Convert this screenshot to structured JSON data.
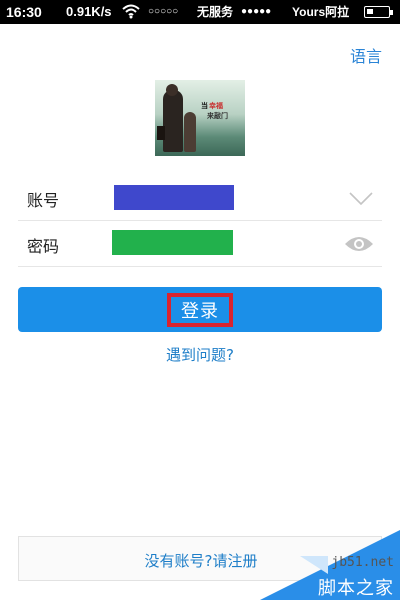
{
  "status_bar": {
    "time": "16:30",
    "net_speed": "0.91K/s",
    "wifi_icon": "wifi-icon",
    "signal_sim1": "○○○○○",
    "no_service": "无服务",
    "signal_sim2": "●●●●●",
    "carrier": "Yours阿拉",
    "battery_icon": "battery-icon"
  },
  "header": {
    "language_link": "语言"
  },
  "avatar": {
    "caption_1": "当",
    "caption_2": "幸福",
    "caption_3": "来敲门"
  },
  "form": {
    "account_label": "账号",
    "account_value": "",
    "account_dropdown_icon": "chevron-down-icon",
    "password_label": "密码",
    "password_value": "",
    "password_toggle_icon": "eye-icon",
    "account_field_color": "#3f48cc",
    "password_field_color": "#22b14c"
  },
  "actions": {
    "login_label": "登录",
    "login_color": "#1b8fe8",
    "highlight_color": "#d8232f",
    "help_link": "遇到问题?",
    "register_link": "没有账号?请注册"
  },
  "watermark": {
    "site": "jb51.net",
    "brand": "脚本之家"
  }
}
